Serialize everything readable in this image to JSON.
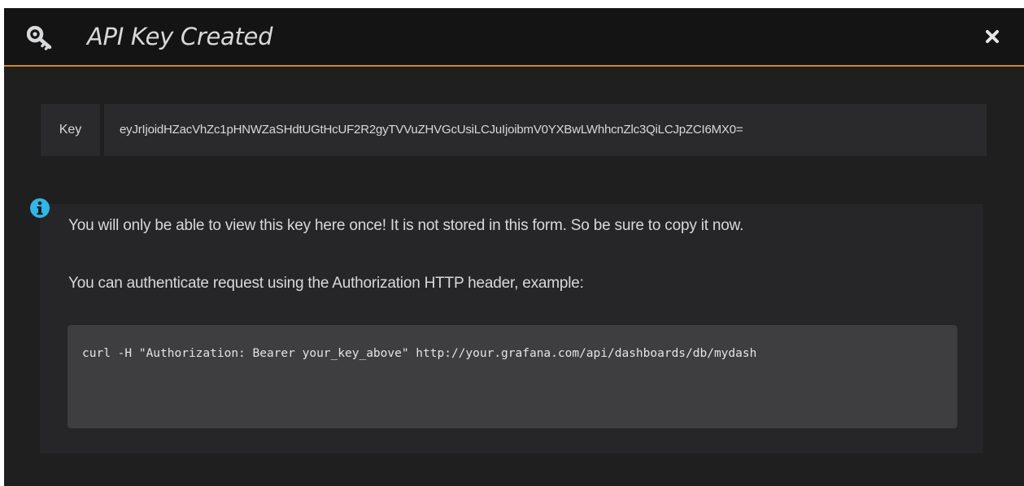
{
  "modal": {
    "title": "API Key Created",
    "header_icon": "key-icon",
    "close_icon": "close-icon"
  },
  "key": {
    "label": "Key",
    "value": "eyJrIjoidHZacVhZc1pHNWZaSHdtUGtHcUF2R2gyTVVuZHVGcUsiLCJuIjoibmV0YXBwLWhhcnZlc3QiLCJpZCI6MX0="
  },
  "info": {
    "icon": "info-icon",
    "line1": "You will only be able to view this key here once! It is not stored in this form. So be sure to copy it now.",
    "line2": "You can authenticate request using the Authorization HTTP header, example:",
    "code": "curl -H \"Authorization: Bearer your_key_above\" http://your.grafana.com/api/dashboards/db/mydash"
  },
  "colors": {
    "modal_bg": "#1f1f20",
    "header_bg": "#141414",
    "accent": "#d08a1f",
    "info_icon": "#33b5e5",
    "text": "#d8d9da"
  }
}
